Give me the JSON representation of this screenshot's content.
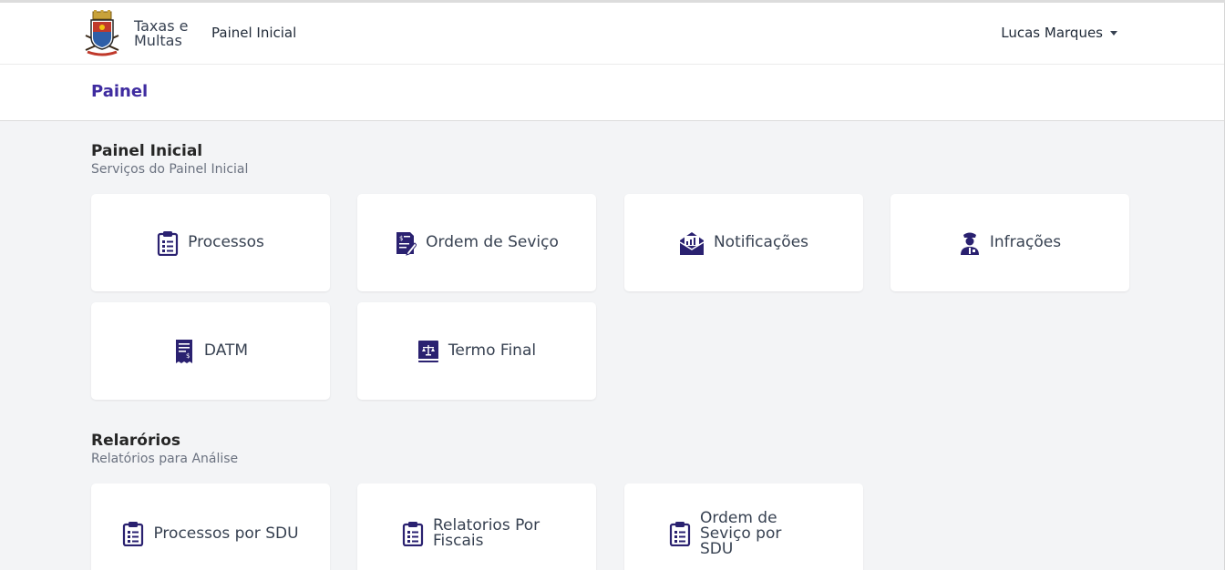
{
  "app": {
    "brand_line1": "Taxas e",
    "brand_line2": "Multas"
  },
  "nav": {
    "home_link": "Painel Inicial",
    "user_name": "Lucas Marques"
  },
  "page": {
    "title": "Painel"
  },
  "sections": [
    {
      "title": "Painel Inicial",
      "subtitle": "Serviços do Painel Inicial",
      "cards": [
        {
          "label": "Processos",
          "icon": "clipboard-list-icon"
        },
        {
          "label": "Ordem de Seviço",
          "icon": "document-edit-icon"
        },
        {
          "label": "Notificações",
          "icon": "envelope-chart-icon"
        },
        {
          "label": "Infrações",
          "icon": "police-officer-icon"
        },
        {
          "label": "DATM",
          "icon": "receipt-icon"
        },
        {
          "label": "Termo Final",
          "icon": "law-book-icon"
        }
      ]
    },
    {
      "title": "Relarórios",
      "subtitle": "Relatórios para Análise",
      "cards": [
        {
          "label": "Processos por SDU",
          "icon": "clipboard-list-icon"
        },
        {
          "label": "Relatorios Por Fiscais",
          "icon": "clipboard-list-icon"
        },
        {
          "label": "Ordem de Seviço por SDU",
          "icon": "clipboard-list-icon"
        }
      ]
    }
  ],
  "colors": {
    "accent": "#3f2ca0",
    "icon": "#2a2170",
    "background": "#f3f4f6"
  }
}
